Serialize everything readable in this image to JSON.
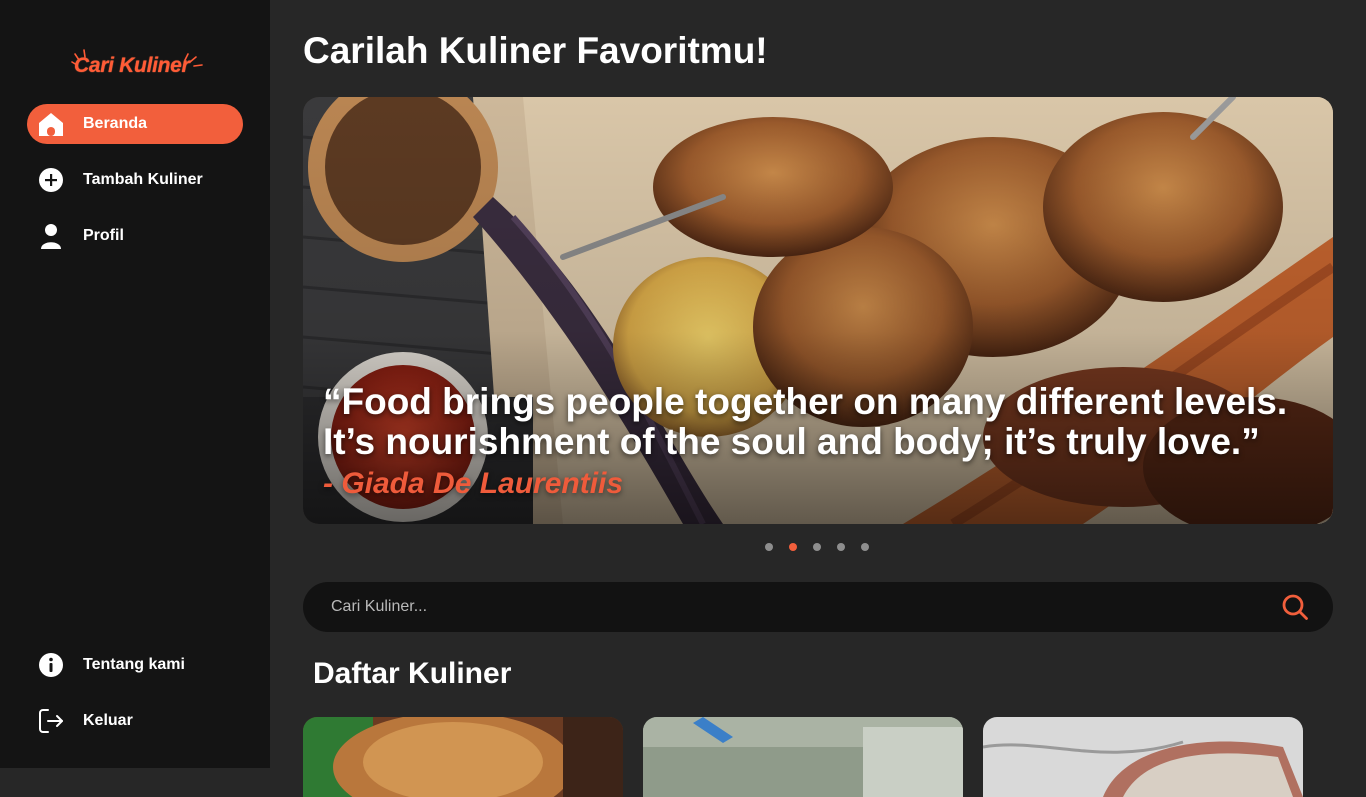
{
  "brand": {
    "logo_text": "Cari Kuliner"
  },
  "sidebar": {
    "items": [
      {
        "label": "Beranda",
        "icon": "home-icon",
        "active": true
      },
      {
        "label": "Tambah Kuliner",
        "icon": "plus-circle-icon",
        "active": false
      },
      {
        "label": "Profil",
        "icon": "user-icon",
        "active": false
      }
    ],
    "bottom_items": [
      {
        "label": "Tentang kami",
        "icon": "info-icon"
      },
      {
        "label": "Keluar",
        "icon": "logout-icon"
      }
    ]
  },
  "main": {
    "title": "Carilah Kuliner Favoritmu!",
    "carousel": {
      "quote": "“Food brings people together on many different levels. It’s nourishment of the soul and body; it’s truly love.”",
      "author": "- Giada De Laurentiis",
      "slide_count": 5,
      "active_index": 1
    },
    "search": {
      "placeholder": "Cari Kuliner...",
      "value": ""
    },
    "list_title": "Daftar Kuliner"
  },
  "colors": {
    "accent": "#f25f3c",
    "sidebar_bg": "#141414",
    "main_bg": "#272727"
  }
}
